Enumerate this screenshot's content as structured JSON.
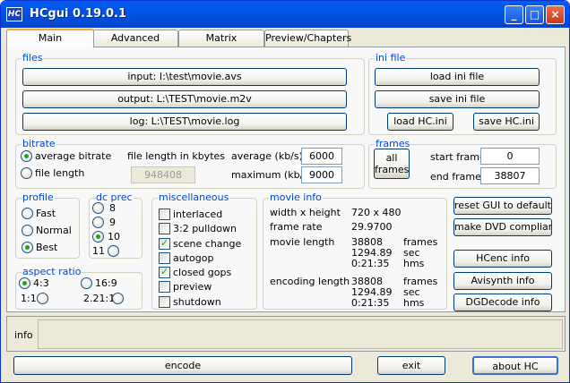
{
  "window": {
    "title": "HCgui 0.19.0.1",
    "icon": "HC"
  },
  "caption_buttons": {
    "minimize": "_",
    "maximize": "□",
    "close": "×"
  },
  "tabs": [
    "Main",
    "Advanced",
    "Matrix",
    "Preview/Chapters"
  ],
  "files": {
    "legend": "files",
    "input": "input: I:\\test\\movie.avs",
    "output": "output: L:\\TEST\\movie.m2v",
    "log": "log: L:\\TEST\\movie.log"
  },
  "ini": {
    "legend": "ini file",
    "load": "load ini file",
    "save": "save ini file",
    "load_hc": "load HC.ini",
    "save_hc": "save HC.ini"
  },
  "bitrate": {
    "legend": "bitrate",
    "avg_label": "average bitrate",
    "avg_selected": true,
    "len_label": "file length",
    "len_selected": false,
    "file_length_label": "file length in kbytes",
    "file_length_value": "948408",
    "average_label": "average (kb/s)",
    "average_value": "6000",
    "maximum_label": "maximum (kb/s)",
    "maximum_value": "9000"
  },
  "frames": {
    "legend": "frames",
    "all": "all frames",
    "start_label": "start frame",
    "start_value": "0",
    "end_label": "end frame",
    "end_value": "38807"
  },
  "profile": {
    "legend": "profile",
    "options": [
      "Fast",
      "Normal",
      "Best"
    ],
    "selected": "Best"
  },
  "dcprec": {
    "legend": "dc prec",
    "options": [
      "8",
      "9",
      "10",
      "11"
    ],
    "selected": "10"
  },
  "aspect": {
    "legend": "aspect ratio",
    "options": [
      "4:3",
      "16:9",
      "1:1",
      "2.21:1"
    ],
    "selected": "4:3"
  },
  "misc": {
    "legend": "miscellaneous",
    "items": [
      {
        "label": "interlaced",
        "checked": false
      },
      {
        "label": "3:2 pulldown",
        "checked": false
      },
      {
        "label": "scene change",
        "checked": true
      },
      {
        "label": "autogop",
        "checked": false
      },
      {
        "label": "closed gops",
        "checked": true
      },
      {
        "label": "preview",
        "checked": false
      },
      {
        "label": "shutdown",
        "checked": false
      }
    ]
  },
  "movie": {
    "legend": "movie info",
    "wh_label": "width x height",
    "wh_value": "720 x 480",
    "fr_label": "frame rate",
    "fr_value": "29.9700",
    "ml_label": "movie length",
    "ml_values": [
      "38808",
      "1294.89",
      "0:21:35"
    ],
    "ml_units": [
      "frames",
      "sec",
      "hms"
    ],
    "el_label": "encoding length",
    "el_values": [
      "38808",
      "1294.89",
      "0:21:35"
    ],
    "el_units": [
      "frames",
      "sec",
      "hms"
    ]
  },
  "side_buttons": [
    "reset GUI to default",
    "make DVD compliant",
    "HCenc info",
    "Avisynth info",
    "DGDecode info"
  ],
  "info": {
    "label": "info",
    "text": ""
  },
  "bottom": {
    "encode": "encode",
    "exit": "exit",
    "about": "about HC"
  }
}
